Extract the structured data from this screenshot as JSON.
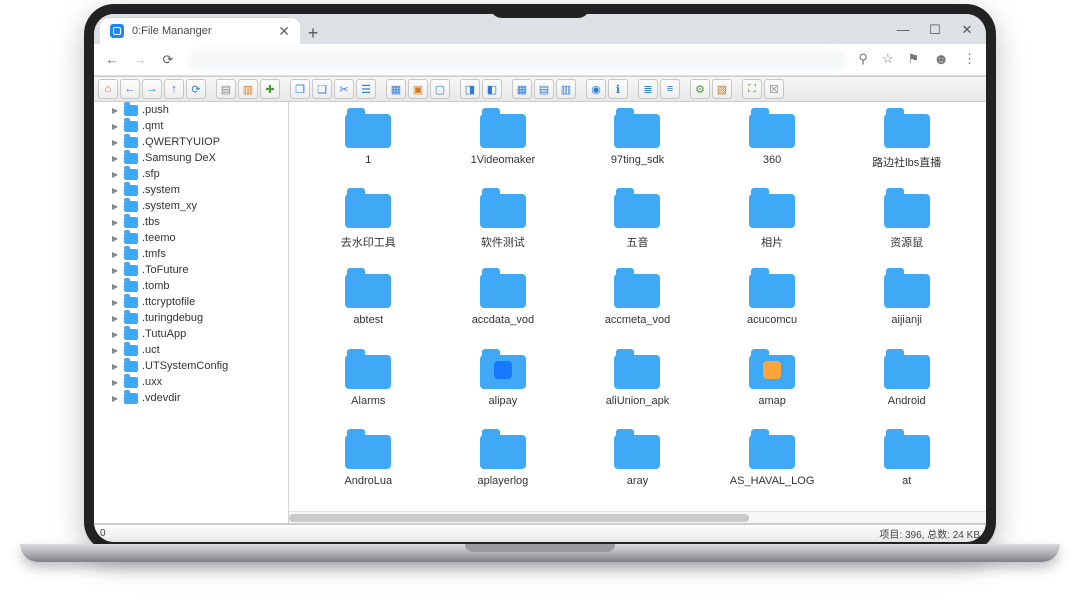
{
  "browser": {
    "tab_title": "0:File Mananger",
    "win_min": "—",
    "win_max": "☐",
    "win_close": "✕",
    "new_tab": "+",
    "close_tab": "✕"
  },
  "status": {
    "left": "0",
    "right": "项目: 396, 总数: 24 KB"
  },
  "sidebar": [
    ".push",
    ".qmt",
    ".QWERTYUIOP",
    ".Samsung DeX",
    ".sfp",
    ".system",
    ".system_xy",
    ".tbs",
    ".teemo",
    ".tmfs",
    ".ToFuture",
    ".tomb",
    ".ttcryptofile",
    ".turingdebug",
    ".TutuApp",
    ".uct",
    ".UTSystemConfig",
    ".uxx",
    ".vdevdir"
  ],
  "folders": [
    {
      "name": "1"
    },
    {
      "name": "1Videomaker"
    },
    {
      "name": "97ting_sdk"
    },
    {
      "name": "360"
    },
    {
      "name": "路边社lbs直播"
    },
    {
      "name": "去水印工具"
    },
    {
      "name": "软件测试"
    },
    {
      "name": "五音"
    },
    {
      "name": "相片"
    },
    {
      "name": "资源鼠"
    },
    {
      "name": "abtest"
    },
    {
      "name": "accdata_vod"
    },
    {
      "name": "accmeta_vod"
    },
    {
      "name": "acucomcu"
    },
    {
      "name": "aijianji"
    },
    {
      "name": "Alarms"
    },
    {
      "name": "alipay",
      "overlay": "#1677ff"
    },
    {
      "name": "aliUnion_apk"
    },
    {
      "name": "amap",
      "overlay": "#ffa53a"
    },
    {
      "name": "Android"
    },
    {
      "name": "AndroLua"
    },
    {
      "name": "aplayerlog"
    },
    {
      "name": "aray"
    },
    {
      "name": "AS_HAVAL_LOG"
    },
    {
      "name": "at"
    }
  ],
  "toolbar": [
    {
      "name": "home-icon",
      "tone": "orange",
      "g": "⌂"
    },
    {
      "name": "back-icon",
      "tone": "blue",
      "g": "←"
    },
    {
      "name": "forward-icon",
      "tone": "blue",
      "g": "→"
    },
    {
      "name": "up-icon",
      "tone": "blue",
      "g": "↑"
    },
    {
      "name": "reload-icon",
      "tone": "blue",
      "g": "⟳"
    },
    {
      "sep": true
    },
    {
      "name": "new-file-icon",
      "tone": "grey",
      "g": "▤"
    },
    {
      "name": "open-file-icon",
      "tone": "orange",
      "g": "▥"
    },
    {
      "name": "save-icon",
      "tone": "green",
      "g": "✚"
    },
    {
      "sep": true
    },
    {
      "name": "copy-icon",
      "tone": "blue",
      "g": "❐"
    },
    {
      "name": "paste-icon",
      "tone": "blue",
      "g": "❏"
    },
    {
      "name": "cut-icon",
      "tone": "blue",
      "g": "✂"
    },
    {
      "name": "clipboard-icon",
      "tone": "blue",
      "g": "☰"
    },
    {
      "sep": true
    },
    {
      "name": "select-all-icon",
      "tone": "blue",
      "g": "▦"
    },
    {
      "name": "delete-icon",
      "tone": "orange",
      "g": "▣"
    },
    {
      "name": "unselect-icon",
      "tone": "blue",
      "g": "▢"
    },
    {
      "sep": true
    },
    {
      "name": "panel-left-icon",
      "tone": "blue",
      "g": "◨"
    },
    {
      "name": "panel-right-icon",
      "tone": "blue",
      "g": "◧"
    },
    {
      "sep": true
    },
    {
      "name": "view-icons-icon",
      "tone": "blue",
      "g": "▦"
    },
    {
      "name": "view-list-icon",
      "tone": "blue",
      "g": "▤"
    },
    {
      "name": "view-tree-icon",
      "tone": "blue",
      "g": "▥"
    },
    {
      "sep": true
    },
    {
      "name": "preview-icon",
      "tone": "blue",
      "g": "◉"
    },
    {
      "name": "info-icon",
      "tone": "blue",
      "g": "ℹ"
    },
    {
      "sep": true
    },
    {
      "name": "sort-icon",
      "tone": "blue",
      "g": "≣"
    },
    {
      "name": "filter-icon",
      "tone": "blue",
      "g": "≡"
    },
    {
      "sep": true
    },
    {
      "name": "settings-icon",
      "tone": "green",
      "g": "⚙"
    },
    {
      "name": "about-icon",
      "tone": "orange",
      "g": "▧"
    },
    {
      "sep": true
    },
    {
      "name": "fullscreen-icon",
      "tone": "green",
      "g": "⛶"
    },
    {
      "name": "close-icon",
      "tone": "grey",
      "g": "☒"
    }
  ]
}
